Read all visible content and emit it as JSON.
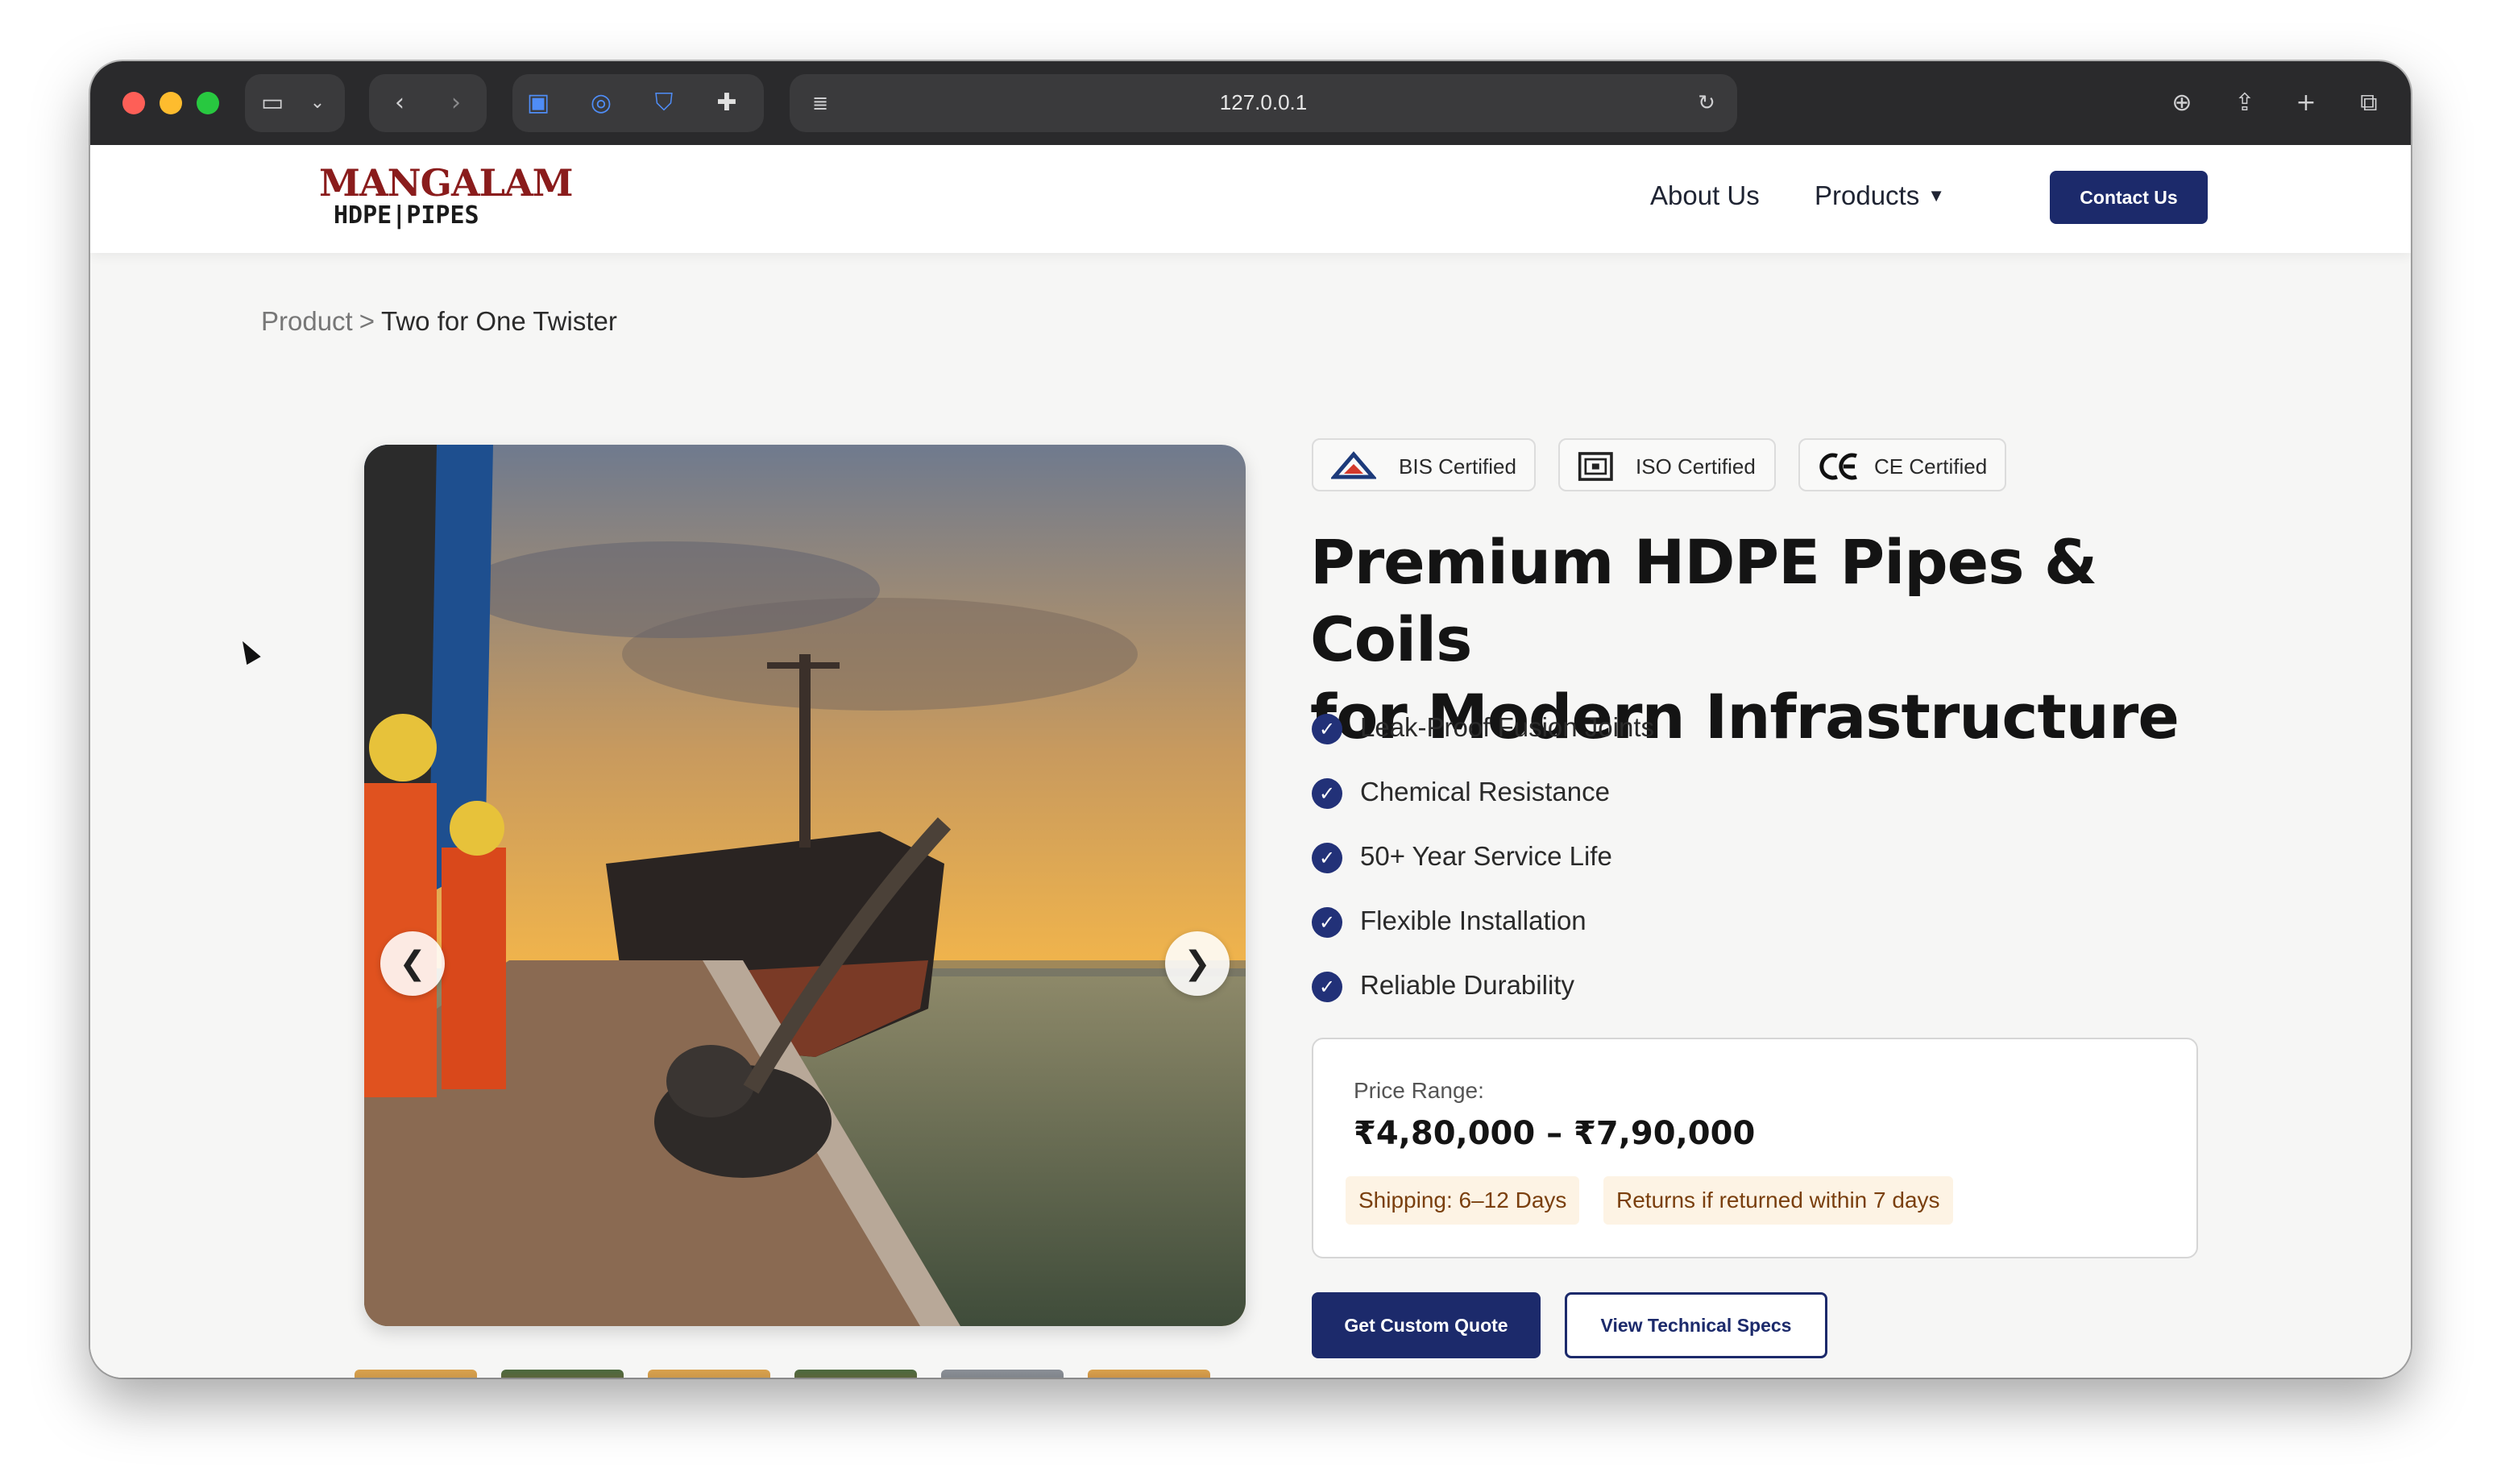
{
  "browser": {
    "url": "127.0.0.1",
    "icons": [
      "sidebar-icon",
      "chevron-down-icon",
      "back-icon",
      "forward-icon",
      "extension-icon",
      "extension-icon",
      "shield-icon",
      "extension-icon",
      "reader-icon",
      "reload-icon",
      "download-icon",
      "share-icon",
      "new-tab-icon",
      "tabs-overview-icon"
    ]
  },
  "nav": {
    "logo_top": "MANGALAM",
    "logo_bottom": "HDPE|PIPES",
    "about": "About Us",
    "products": "Products",
    "contact": "Contact Us"
  },
  "breadcrumb": {
    "root": "Product",
    "separator": ">",
    "current": "Two for One Twister"
  },
  "carousel": {
    "prev": "❮",
    "next": "❯",
    "thumbnail_count": 6
  },
  "badges": [
    {
      "label": "BIS Certified",
      "icon": "bis-icon"
    },
    {
      "label": "ISO Certified",
      "icon": "iso-icon"
    },
    {
      "label": "CE Certified",
      "icon": "ce-icon"
    }
  ],
  "product": {
    "headline_line1": "Premium HDPE Pipes & Coils",
    "headline_line2": "for Modern Infrastructure",
    "features": [
      "Leak-Proof Fusion Joints",
      "Chemical Resistance",
      "50+ Year Service Life",
      "Flexible Installation",
      "Reliable Durability"
    ]
  },
  "pricing": {
    "label": "Price Range:",
    "value": "₹4,80,000 – ₹7,90,000",
    "shipping": "Shipping: 6–12 Days",
    "returns": "Returns if returned within 7 days"
  },
  "actions": {
    "quote": "Get Custom Quote",
    "specs": "View Technical Specs"
  },
  "colors": {
    "brand_navy": "#1c2a6b",
    "logo_red": "#8a1c1c",
    "chip_bg": "#fdf3e4"
  }
}
